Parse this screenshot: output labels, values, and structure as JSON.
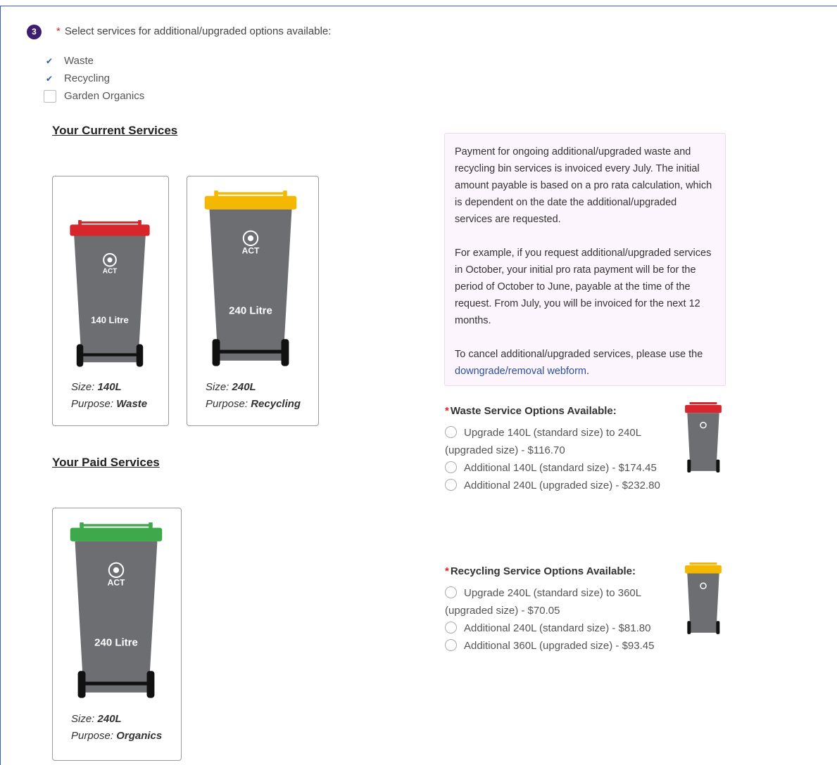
{
  "question": {
    "step": "3",
    "required_mark": "*",
    "text": "Select services for additional/upgraded options available:"
  },
  "service_checkboxes": [
    {
      "label": "Waste",
      "checked": true
    },
    {
      "label": "Recycling",
      "checked": true
    },
    {
      "label": "Garden Organics",
      "checked": false
    }
  ],
  "current_services": {
    "heading": "Your Current Services",
    "bins": [
      {
        "capacity_label": "140 Litre",
        "brand": "ACT",
        "size_label": "Size:",
        "size": "140L",
        "purpose_label": "Purpose:",
        "purpose": "Waste",
        "lid_color": "#d7262c"
      },
      {
        "capacity_label": "240 Litre",
        "brand": "ACT",
        "size_label": "Size:",
        "size": "240L",
        "purpose_label": "Purpose:",
        "purpose": "Recycling",
        "lid_color": "#f5b800"
      }
    ]
  },
  "paid_services": {
    "heading": "Your Paid Services",
    "bins": [
      {
        "capacity_label": "240 Litre",
        "brand": "ACT",
        "size_label": "Size:",
        "size": "240L",
        "purpose_label": "Purpose:",
        "purpose": "Organics",
        "lid_color": "#3ea94a"
      }
    ]
  },
  "info": {
    "para1": "Payment for ongoing additional/upgraded waste and recycling bin services is invoiced every July. The initial amount payable is based on a pro rata calculation, which is dependent on the date the additional/upgraded services are requested.",
    "para2": "For example, if you request additional/upgraded services in October, your initial pro rata payment will be for the period of October to June, payable at the time of the request. From July, you will be invoiced for the next 12 months.",
    "para3_prefix": "To cancel additional/upgraded services, please use the ",
    "para3_link": "downgrade/removal webform",
    "para3_suffix": "."
  },
  "waste_options": {
    "required_mark": "*",
    "title": "Waste Service Options Available:",
    "lid_color": "#d7262c",
    "options": [
      "Upgrade 140L (standard size) to 240L (upgraded size) - $116.70",
      "Additional 140L (standard size) - $174.45",
      "Additional 240L (upgraded size) - $232.80"
    ]
  },
  "recycling_options": {
    "required_mark": "*",
    "title": "Recycling Service Options Available:",
    "lid_color": "#f5b800",
    "options": [
      "Upgrade 240L (standard size) to 360L (upgraded size) - $70.05",
      "Additional 240L (standard size) - $81.80",
      "Additional 360L (upgraded size) - $93.45"
    ]
  },
  "colors": {
    "bin_body": "#6d6e71",
    "step_badge": "#3b1e6e",
    "link": "#2a4f9e",
    "info_bg": "#fdf5fd"
  }
}
